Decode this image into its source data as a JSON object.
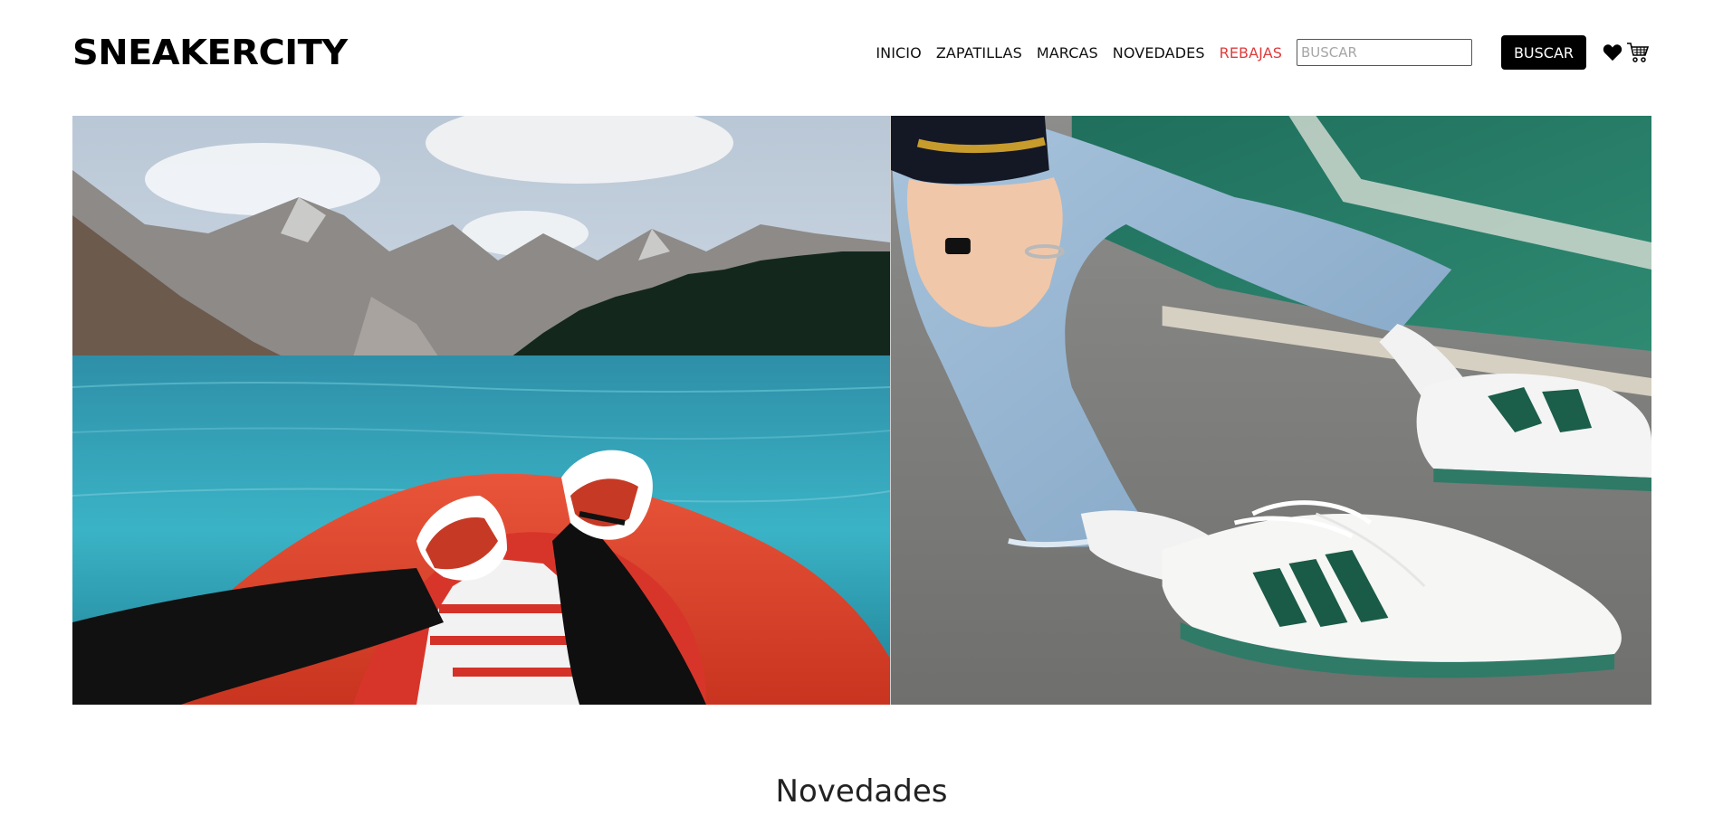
{
  "brand": {
    "logo_text": "SNEAKERCITY"
  },
  "nav": {
    "items": [
      {
        "label": "INICIO"
      },
      {
        "label": "ZAPATILLAS"
      },
      {
        "label": "MARCAS"
      },
      {
        "label": "NOVEDADES"
      },
      {
        "label": "REBAJAS",
        "highlight": true
      }
    ],
    "sale_color": "#e03b3b"
  },
  "search": {
    "placeholder": "BUSCAR",
    "value": "",
    "button_label": "BUSCAR"
  },
  "icons": {
    "favorites": "heart-icon",
    "cart": "cart-icon"
  },
  "hero": {
    "images": [
      {
        "name": "hero-image-lake-kayak",
        "description_icon": "photo"
      },
      {
        "name": "hero-image-sneakers-pavement",
        "description_icon": "photo"
      }
    ]
  },
  "sections": {
    "new_arrivals_title": "Novedades"
  }
}
